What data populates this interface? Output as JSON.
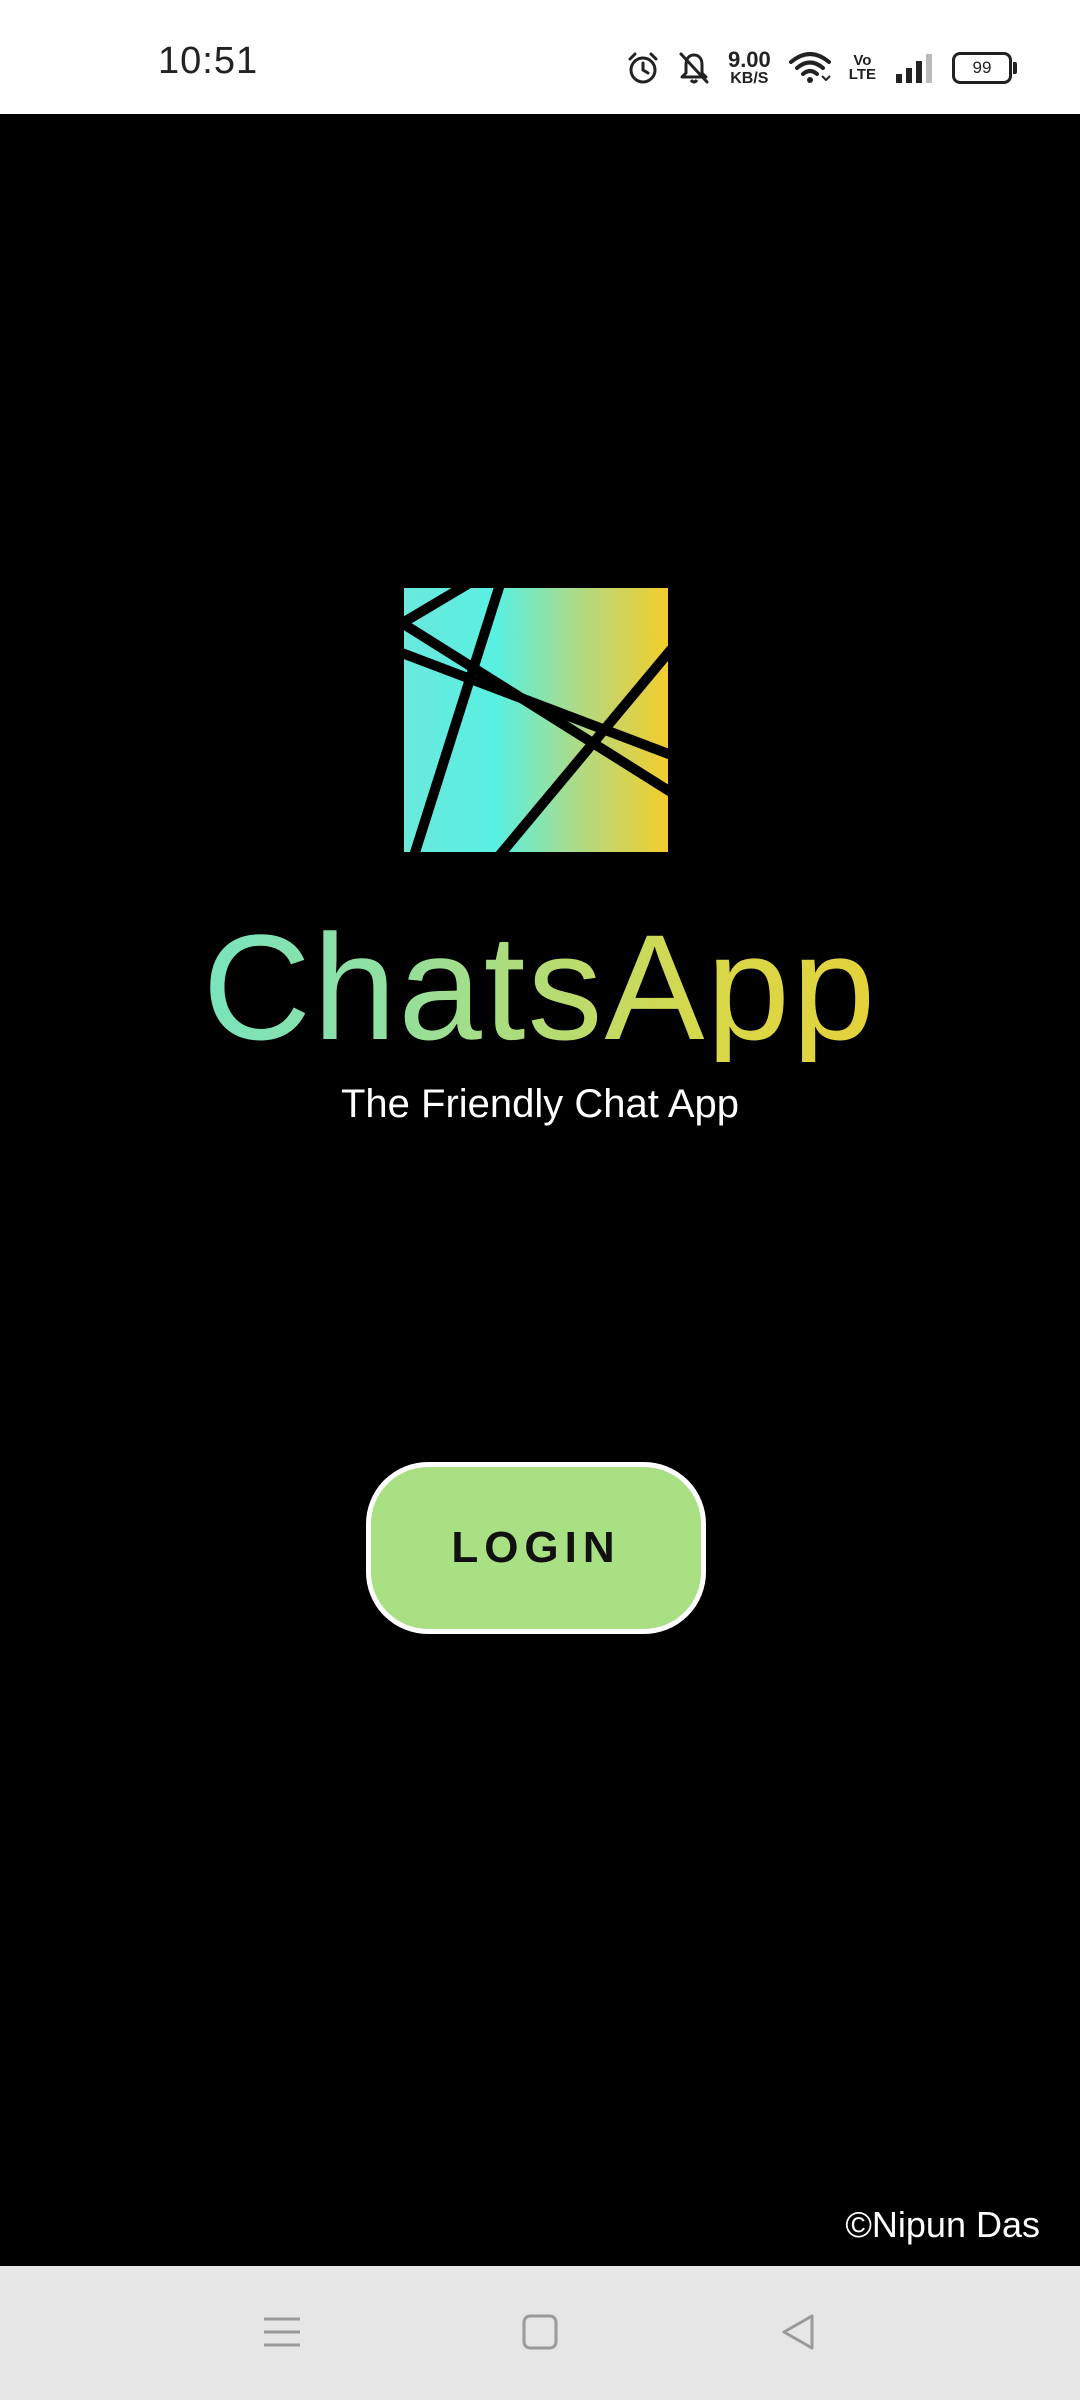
{
  "status_bar": {
    "time": "10:51",
    "net_speed_value": "9.00",
    "net_speed_unit": "KB/S",
    "volte_top": "Vo",
    "volte_bottom": "LTE",
    "battery": "99",
    "icons": [
      "alarm-icon",
      "bell-muted-icon",
      "wifi-icon",
      "signal-icon",
      "battery-icon"
    ]
  },
  "brand": {
    "app_name": "ChatsApp",
    "tagline": "The Friendly Chat App",
    "gradient_colors": [
      "#5fe8dc",
      "#8fe0a2",
      "#d7d84a",
      "#f3c929"
    ]
  },
  "login": {
    "label": "LOGIN",
    "background": "#a8e083"
  },
  "footer": {
    "copyright": "©Nipun Das"
  },
  "nav_bar": {
    "buttons": [
      "menu-icon",
      "home-icon",
      "back-icon"
    ]
  }
}
